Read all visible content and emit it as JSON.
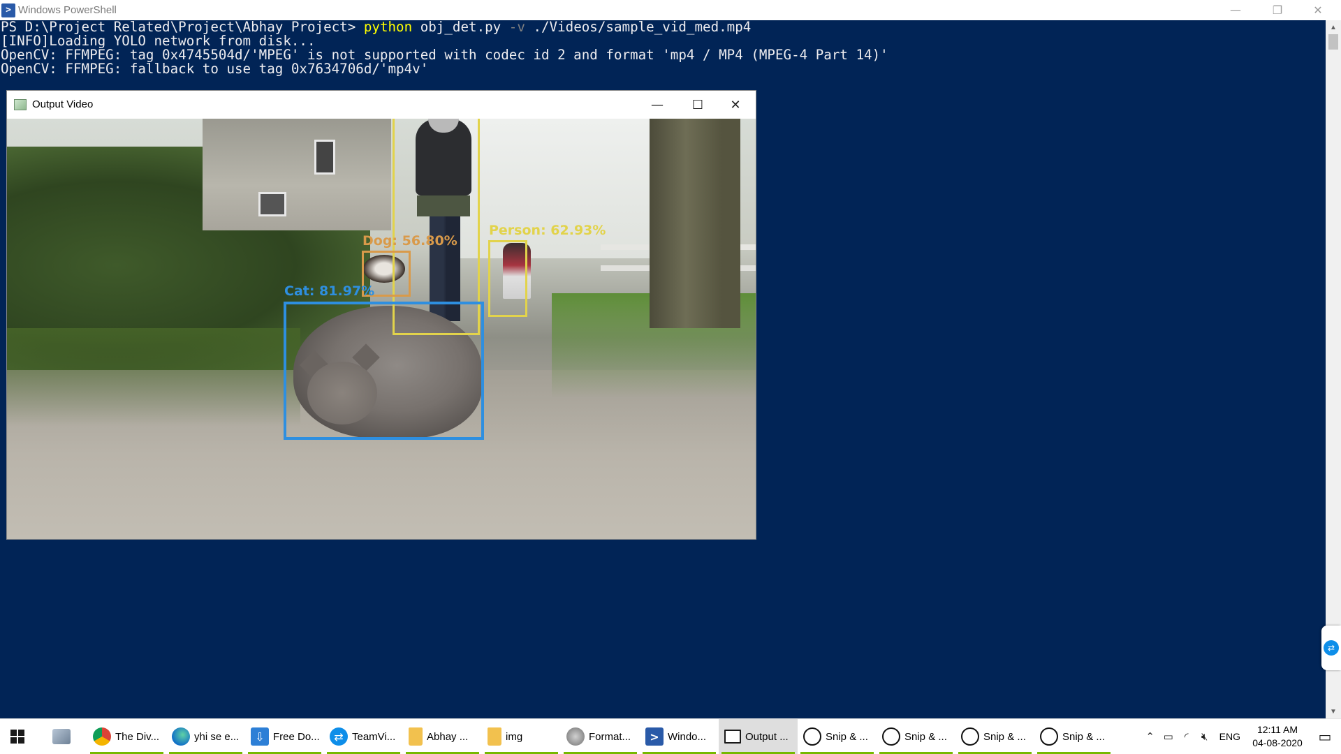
{
  "powershell": {
    "title": "Windows PowerShell",
    "icon": "powershell-icon",
    "controls": {
      "minimize": "—",
      "restore": "❐",
      "close": "✕"
    },
    "lines": [
      [
        {
          "t": "PS D:\\Project Related\\Project\\Abhay Project> ",
          "c": "plain"
        },
        {
          "t": "python",
          "c": "cmd"
        },
        {
          "t": " obj_det.py ",
          "c": "plain"
        },
        {
          "t": "-v",
          "c": "param"
        },
        {
          "t": " ./Videos/sample_vid_med.mp4",
          "c": "plain"
        }
      ],
      [
        {
          "t": "[INFO]Loading YOLO network from disk...",
          "c": "plain"
        }
      ],
      [
        {
          "t": "OpenCV: FFMPEG: tag 0x4745504d/'MPEG' is not supported with codec id 2 and format 'mp4 / MP4 (MPEG-4 Part 14)'",
          "c": "plain"
        }
      ],
      [
        {
          "t": "OpenCV: FFMPEG: fallback to use tag 0x7634706d/'mp4v'",
          "c": "plain"
        }
      ]
    ],
    "colors": {
      "background": "#012456",
      "text": "#eeedf0",
      "command": "#ffff00",
      "parameter": "#808080"
    }
  },
  "output_window": {
    "title": "Output Video",
    "controls": {
      "minimize": "—",
      "maximize": "☐",
      "close": "✕"
    },
    "detections": [
      {
        "label": "Cat: 81.97%",
        "class": "Cat",
        "confidence": 81.97,
        "color": "#2e8fe0"
      },
      {
        "label": "Dog: 56.80%",
        "class": "Dog",
        "confidence": 56.8,
        "color": "#d99a4a"
      },
      {
        "label": "Person: 62.93%",
        "class": "Person",
        "confidence": 62.93,
        "color": "#e2d34b"
      }
    ]
  },
  "taskbar": {
    "start_icon": "windows-start-icon",
    "pinned_icon": "file-explorer-icon",
    "apps": [
      {
        "label": "The Div...",
        "icon": "chrome-icon",
        "active": false,
        "running": true
      },
      {
        "label": "yhi se e...",
        "icon": "edge-icon",
        "active": false,
        "running": true
      },
      {
        "label": "Free Do...",
        "icon": "free-download-icon",
        "active": false,
        "running": true
      },
      {
        "label": "TeamVi...",
        "icon": "teamviewer-icon",
        "active": false,
        "running": true
      },
      {
        "label": "Abhay ...",
        "icon": "folder-icon",
        "active": false,
        "running": true
      },
      {
        "label": "img",
        "icon": "folder-icon",
        "active": false,
        "running": true
      },
      {
        "label": "Format...",
        "icon": "format-factory-icon",
        "active": false,
        "running": true
      },
      {
        "label": "Windo...",
        "icon": "powershell-icon",
        "active": false,
        "running": true
      },
      {
        "label": "Output ...",
        "icon": "output-window-icon",
        "active": true,
        "running": true
      },
      {
        "label": "Snip & ...",
        "icon": "snip-sketch-icon",
        "active": false,
        "running": true
      },
      {
        "label": "Snip & ...",
        "icon": "snip-sketch-icon",
        "active": false,
        "running": true
      },
      {
        "label": "Snip & ...",
        "icon": "snip-sketch-icon",
        "active": false,
        "running": true
      },
      {
        "label": "Snip & ...",
        "icon": "snip-sketch-icon",
        "active": false,
        "running": true
      }
    ],
    "tray": {
      "icons": [
        "chevron-up-icon",
        "battery-icon",
        "wifi-icon",
        "volume-muted-icon"
      ],
      "language": "ENG",
      "time": "12:11 AM",
      "date": "04-08-2020",
      "notification_icon": "action-center-icon"
    }
  }
}
